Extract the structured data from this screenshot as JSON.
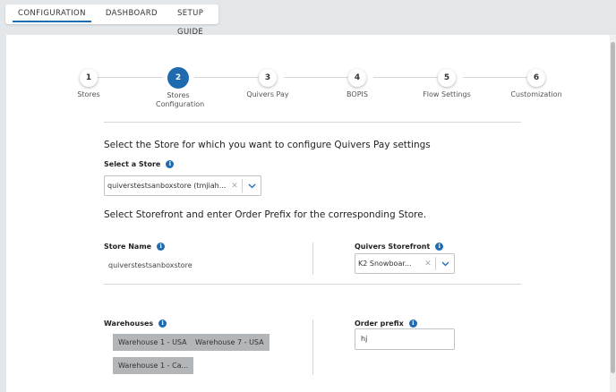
{
  "tabs": [
    {
      "label": "CONFIGURATION",
      "active": true
    },
    {
      "label": "DASHBOARD",
      "active": false
    },
    {
      "label": "SETUP GUIDE",
      "active": false
    }
  ],
  "steps": [
    {
      "num": "1",
      "label": "Stores",
      "active": false
    },
    {
      "num": "2",
      "label": "Stores Configuration",
      "active": true
    },
    {
      "num": "3",
      "label": "Quivers Pay",
      "active": false
    },
    {
      "num": "4",
      "label": "BOPIS",
      "active": false
    },
    {
      "num": "5",
      "label": "Flow Settings",
      "active": false
    },
    {
      "num": "6",
      "label": "Customization",
      "active": false
    }
  ],
  "store_section": {
    "title": "Select the Store for which you want to configure Quivers Pay settings",
    "select_label": "Select a Store",
    "selected_value": "quiverstestsanboxstore (tmjiah..."
  },
  "storefront_section": {
    "title": "Select Storefront and enter Order Prefix for the corresponding Store.",
    "store_name_label": "Store Name",
    "store_name_value": "quiverstestsanboxstore",
    "storefront_label": "Quivers Storefront",
    "storefront_value": "K2 Snowboar..."
  },
  "warehouses": {
    "label": "Warehouses",
    "chips": [
      "Warehouse 1 - USA",
      "Warehouse 7 - USA",
      "Warehouse 1 - Ca..."
    ]
  },
  "order_prefix": {
    "label": "Order prefix",
    "value": "hj"
  },
  "icons": {
    "info": "info-icon",
    "clear": "close-icon",
    "dropdown": "chevron-down-icon"
  },
  "colors": {
    "accent": "#1f6bb0",
    "chip_bg": "#b3b6b9",
    "page_bg": "#e4e7ea"
  }
}
